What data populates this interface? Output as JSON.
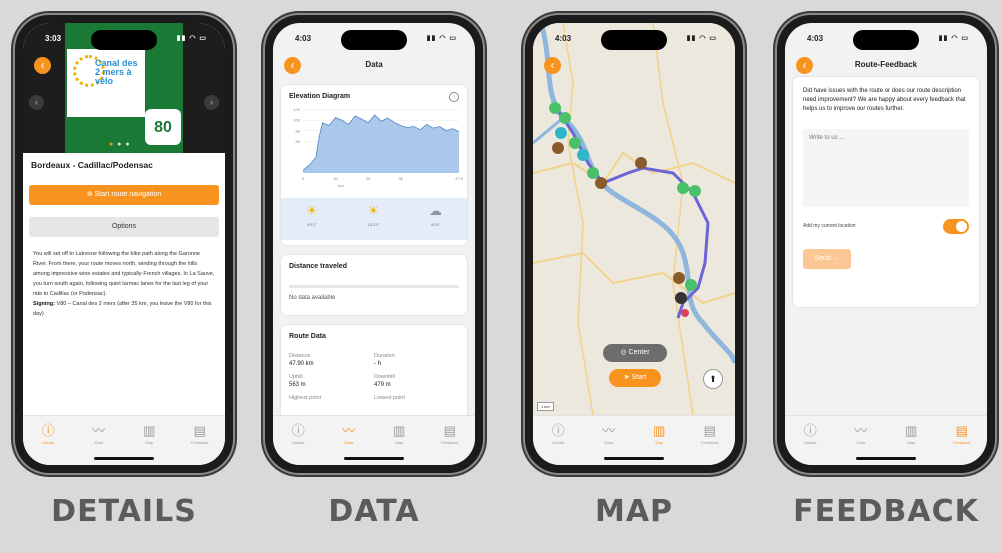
{
  "status": {
    "time_1": "3:03",
    "time_2": "4:03",
    "time_3": "4:03",
    "time_4": "4:03"
  },
  "icons": {
    "back": "chevron-left-icon",
    "signal": "signal-icon",
    "wifi": "wifi-icon",
    "battery": "battery-icon"
  },
  "tabs": [
    {
      "label": "Details",
      "icon": "info-circle-icon"
    },
    {
      "label": "Data",
      "icon": "chart-line-icon"
    },
    {
      "label": "Map",
      "icon": "map-icon"
    },
    {
      "label": "Feedback",
      "icon": "clipboard-icon"
    }
  ],
  "details": {
    "logo_text": "Canal des 2 mers à vélo",
    "route_number": "80",
    "route_title": "Bordeaux - Cadillac/Podensac",
    "start_button": "Start route navigation",
    "options_button": "Options",
    "description": "You will set off to Latresne following the bike path along the Garonne River. From there, your route moves north, winding through the hills among impressive wine estates and typically-French villages. In La Sauve, you turn south again, following quiet tarmac lanes for the last leg of your ride to Cadillac (or Podensac).",
    "signing_label": "Signing:",
    "signing_text": "V80 – Canal des 2 mers (after 35 km, you leave the V80 for this day)"
  },
  "data": {
    "nav_title": "Data",
    "elevation_title": "Elevation Diagram",
    "elevation_x_ticks": [
      "0",
      "10",
      "20",
      "30",
      "47.9"
    ],
    "elevation_y_ticks": [
      "120",
      "100",
      "80",
      "60"
    ],
    "elevation_xlabel": "km",
    "weather": [
      {
        "temp": "9/12°",
        "icon": "sun-cloud-icon"
      },
      {
        "temp": "10/13°",
        "icon": "sun-cloud-icon"
      },
      {
        "temp": "9/14°",
        "icon": "cloud-icon"
      }
    ],
    "distance_title": "Distance traveled",
    "distance_progress": 0,
    "no_data": "No data available",
    "route_data_title": "Route Data",
    "stats": [
      {
        "label": "Distance",
        "value": "47.90 km"
      },
      {
        "label": "Duration",
        "value": "- h"
      },
      {
        "label": "Uphill",
        "value": "563 m"
      },
      {
        "label": "Downhill",
        "value": "479 m"
      },
      {
        "label": "Highest point",
        "value": ""
      },
      {
        "label": "Lowest point",
        "value": ""
      }
    ]
  },
  "chart_data": {
    "type": "area",
    "title": "Elevation Diagram",
    "xlabel": "km",
    "ylabel": "",
    "xlim": [
      0,
      47.9
    ],
    "ylim": [
      0,
      125
    ],
    "x": [
      0,
      2,
      4,
      5,
      6,
      8,
      10,
      12,
      14,
      16,
      18,
      20,
      22,
      24,
      26,
      28,
      30,
      32,
      34,
      36,
      38,
      40,
      42,
      44,
      46,
      47.9
    ],
    "y": [
      5,
      15,
      30,
      70,
      95,
      90,
      105,
      100,
      92,
      108,
      102,
      95,
      110,
      98,
      104,
      96,
      90,
      86,
      88,
      82,
      92,
      85,
      88,
      80,
      84,
      78
    ]
  },
  "map": {
    "center_button": "Center",
    "start_button": "Start",
    "scale_text": "1 km"
  },
  "feedback": {
    "nav_title": "Route-Feedback",
    "question": "Did have issues with the route or does our route description need improvement? We are happy about every feedback that helps us to improve our routes further.",
    "placeholder": "Write to us ...",
    "toggle_label": "Add my current location",
    "toggle_on": true,
    "send_button": "Send"
  },
  "captions": [
    "DETAILS",
    "DATA",
    "MAP",
    "FEEDBACK"
  ],
  "colors": {
    "accent": "#f7931e",
    "route_line": "#6b63d6",
    "elevation_fill": "#a9c8ea",
    "elevation_stroke": "#4f86c6"
  }
}
